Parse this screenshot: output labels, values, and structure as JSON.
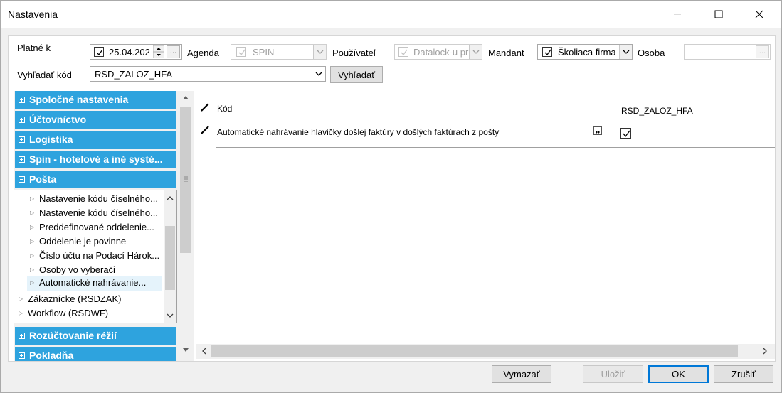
{
  "window": {
    "title": "Nastavenia"
  },
  "filters": {
    "platne_k_label": "Platné k",
    "date_value": "25.04.202",
    "browse_label": "...",
    "agenda_label": "Agenda",
    "agenda_value": "SPIN",
    "pouzivatel_label": "Používateľ",
    "pouzivatel_value": "Datalock-u pr",
    "mandant_label": "Mandant",
    "mandant_value": "Školiaca firma",
    "osoba_label": "Osoba",
    "osoba_browse_label": "...",
    "vyhladat_kod_label": "Vyhľadať kód",
    "kod_value": "RSD_ZALOZ_HFA",
    "search_button": "Vyhľadať"
  },
  "categories": [
    {
      "label": "Spoločné nastavenia"
    },
    {
      "label": "Účtovníctvo"
    },
    {
      "label": "Logistika"
    },
    {
      "label": "Spin - hotelové a iné systé..."
    },
    {
      "label": "Pošta"
    }
  ],
  "sub_items": [
    {
      "label": "Nastavenie kódu číselného..."
    },
    {
      "label": "Nastavenie kódu číselného..."
    },
    {
      "label": "Preddefinované oddelenie..."
    },
    {
      "label": "Oddelenie je povinne"
    },
    {
      "label": "Číslo účtu na Podací Hárok..."
    },
    {
      "label": "Osoby vo vyberači"
    },
    {
      "label": "Automatické nahrávanie..."
    }
  ],
  "sub_groups": [
    {
      "label": "Zákaznícke (RSDZAK)"
    },
    {
      "label": "Workflow (RSDWF)"
    }
  ],
  "categories_bottom": [
    {
      "label": "Rozúčtovanie réžií"
    },
    {
      "label": "Pokladňa"
    }
  ],
  "settings": {
    "row1_label": "Kód",
    "row1_value": "RSD_ZALOZ_HFA",
    "row2_label": "Automatické nahrávanie hlavičky došlej faktúry v došlých faktúrach z pošty"
  },
  "footer": {
    "vymazat": "Vymazať",
    "ulozit": "Uložiť",
    "ok": "OK",
    "zrusit": "Zrušiť"
  },
  "colors": {
    "category_bg": "#2ea3de",
    "accent": "#0078d7"
  }
}
